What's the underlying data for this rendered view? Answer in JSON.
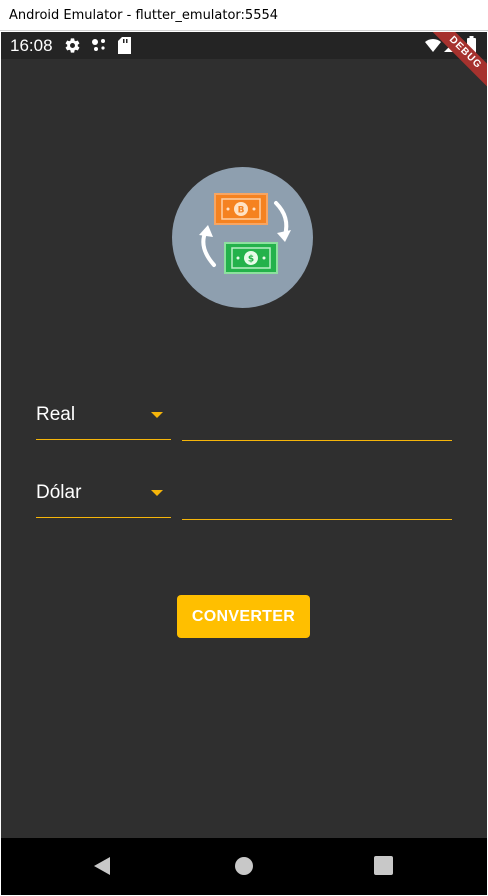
{
  "window": {
    "title": "Android Emulator - flutter_emulator:5554"
  },
  "status_bar": {
    "time": "16:08",
    "icons": [
      "gear-icon",
      "assistant-dots-icon",
      "sd-card-icon",
      "wifi-icon",
      "signal-icon",
      "battery-icon"
    ]
  },
  "debug_banner": {
    "label": "DEBUG"
  },
  "form": {
    "from_currency": "Real",
    "to_currency": "Dólar",
    "from_amount": "",
    "to_amount": ""
  },
  "convert_button": {
    "label": "CONVERTER"
  },
  "nav": {
    "icons": [
      "back-icon",
      "home-icon",
      "recents-icon"
    ]
  },
  "colors": {
    "accent": "#ffbf00",
    "background": "#2f2f2f",
    "underline": "#f5b50a",
    "logo_circle": "#8e9faf"
  }
}
